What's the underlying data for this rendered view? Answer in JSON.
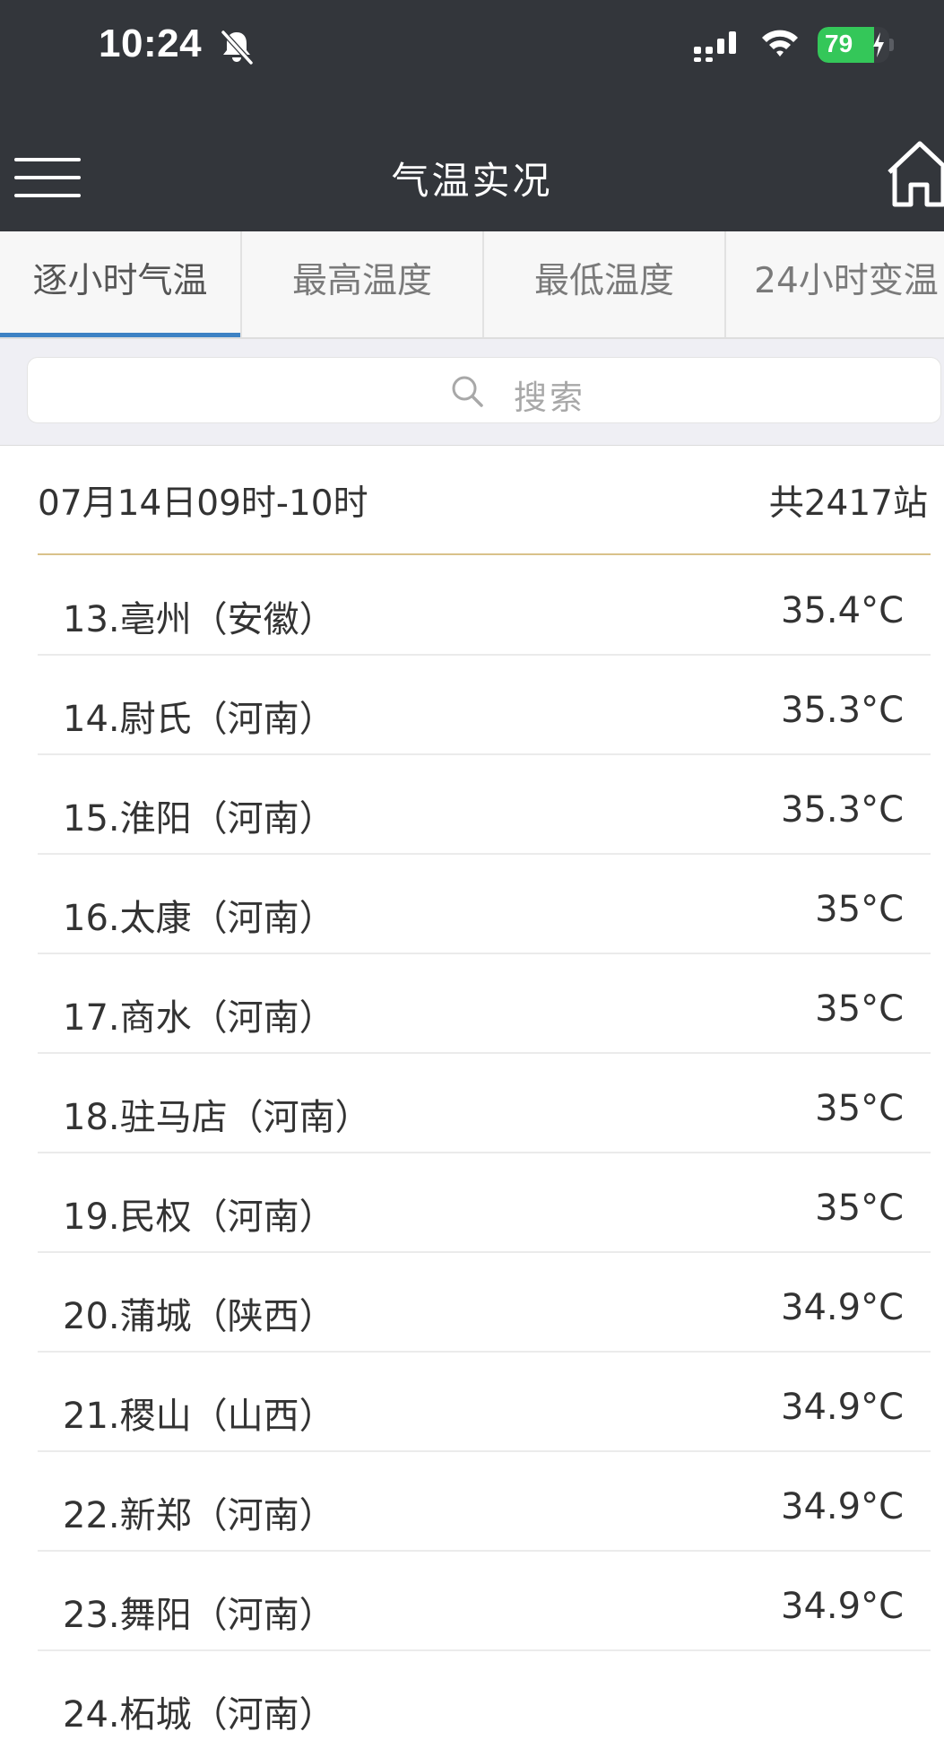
{
  "status_bar": {
    "time": "10:24",
    "battery": "79",
    "battery_level": 0.79
  },
  "nav": {
    "title": "气温实况"
  },
  "tabs": [
    {
      "label": "逐小时气温",
      "active": true
    },
    {
      "label": "最高温度",
      "active": false
    },
    {
      "label": "最低温度",
      "active": false
    },
    {
      "label": "24小时变温",
      "active": false
    }
  ],
  "search": {
    "placeholder": "搜索"
  },
  "info": {
    "date_range": "07月14日09时-10时",
    "station_count": "共2417站"
  },
  "stations": [
    {
      "name": "13.亳州（安徽）",
      "temp": "35.4°C"
    },
    {
      "name": "14.尉氏（河南）",
      "temp": "35.3°C"
    },
    {
      "name": "15.淮阳（河南）",
      "temp": "35.3°C"
    },
    {
      "name": "16.太康（河南）",
      "temp": "35°C"
    },
    {
      "name": "17.商水（河南）",
      "temp": "35°C"
    },
    {
      "name": "18.驻马店（河南）",
      "temp": "35°C"
    },
    {
      "name": "19.民权（河南）",
      "temp": "35°C"
    },
    {
      "name": "20.蒲城（陕西）",
      "temp": "34.9°C"
    },
    {
      "name": "21.稷山（山西）",
      "temp": "34.9°C"
    },
    {
      "name": "22.新郑（河南）",
      "temp": "34.9°C"
    },
    {
      "name": "23.舞阳（河南）",
      "temp": "34.9°C"
    },
    {
      "name": "24.柘城（河南）",
      "temp": ""
    }
  ]
}
